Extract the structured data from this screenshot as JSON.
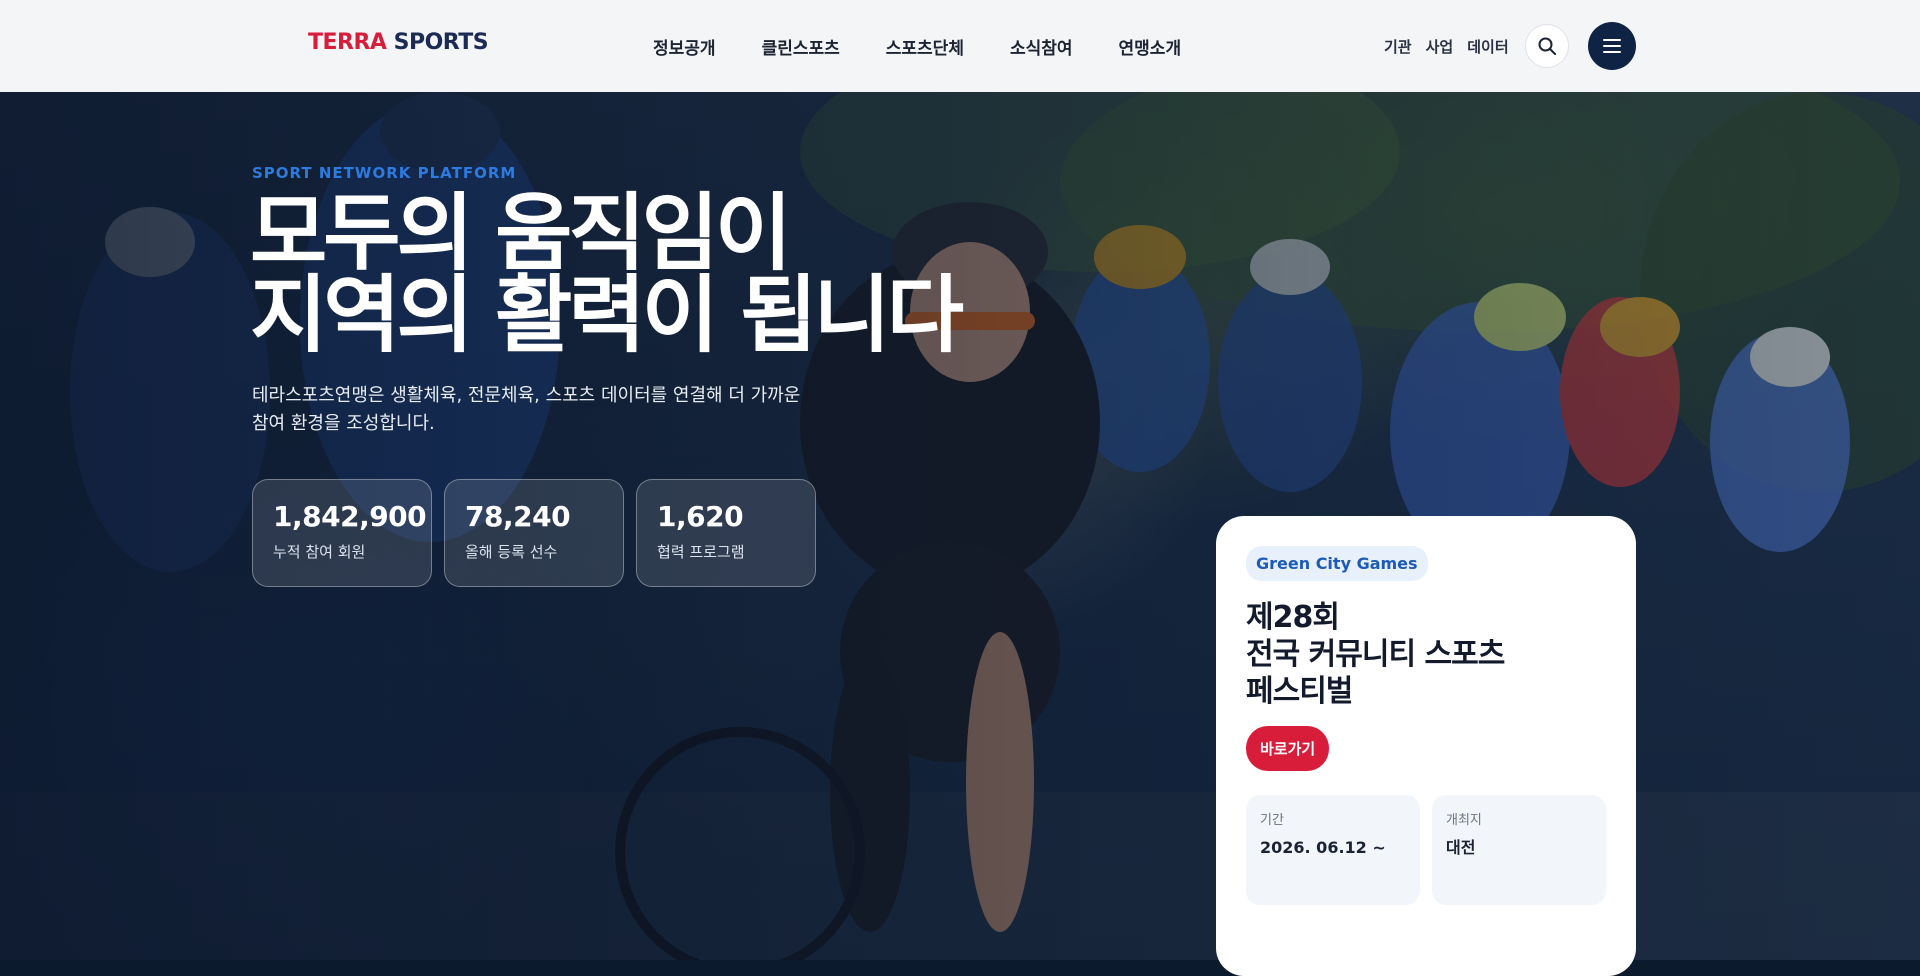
{
  "header": {
    "logo_primary": "TERRA",
    "logo_secondary": "SPORTS",
    "nav": [
      "정보공개",
      "클린스포츠",
      "스포츠단체",
      "소식참여",
      "연맹소개"
    ],
    "utility_links": [
      "기관",
      "사업",
      "데이터"
    ],
    "search_icon": "search-icon",
    "menu_icon": "hamburger-menu-icon"
  },
  "hero": {
    "kicker": "SPORT NETWORK PLATFORM",
    "headline_line1": "모두의 움직임이",
    "headline_line2": "지역의 활력이 됩니다",
    "lead": "테라스포츠연맹은 생활체육, 전문체육, 스포츠 데이터를 연결해 더 가까운 참여 환경을 조성합니다.",
    "stats": [
      {
        "value": "1,842,900",
        "label": "누적 참여 회원"
      },
      {
        "value": "78,240",
        "label": "올해 등록 선수"
      },
      {
        "value": "1,620",
        "label": "협력 프로그램"
      }
    ]
  },
  "event": {
    "chip": "Green City Games",
    "title_line1": "제28회",
    "title_line2": "전국 커뮤니티 스포츠",
    "title_line3": "페스티벌",
    "button": "바로가기",
    "period_label": "기간",
    "period_value": "2026. 06.12 ~",
    "venue_label": "개최지",
    "venue_value": "대전"
  },
  "colors": {
    "brand_red": "#d81d3a",
    "brand_navy": "#1b2b55",
    "accent_blue": "#2d7be0"
  }
}
